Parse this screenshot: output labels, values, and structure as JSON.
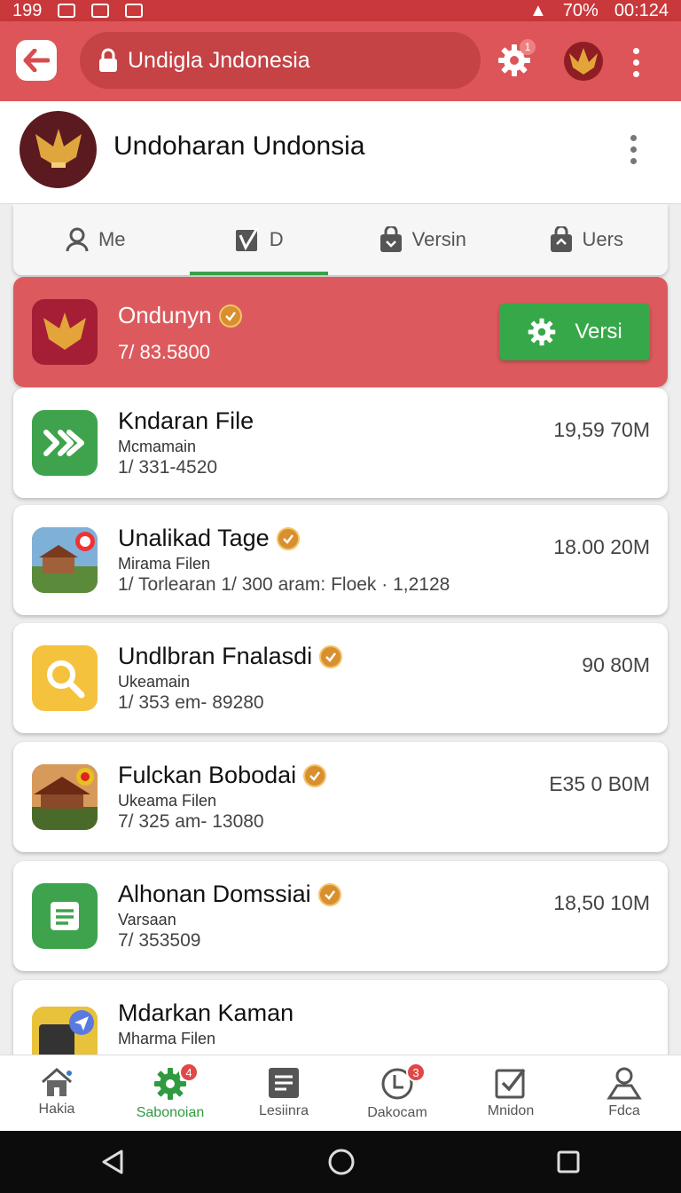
{
  "status_bar": {
    "time_left": "199",
    "battery": "70%",
    "clock": "00:124"
  },
  "app_bar": {
    "url_text": "Undigla Jndonesia",
    "settings_badge": "1"
  },
  "profile": {
    "title": "Undoharan Undonsia"
  },
  "tabs": [
    {
      "label": "Me",
      "icon": "person-icon"
    },
    {
      "label": "D",
      "icon": "edit-box-icon"
    },
    {
      "label": "Versin",
      "icon": "bag-icon"
    },
    {
      "label": "Uers",
      "icon": "bag-icon"
    }
  ],
  "active_tab": 1,
  "featured": {
    "name": "Ondunyn",
    "meta": "7/ 83.5800",
    "button_label": "Versi"
  },
  "items": [
    {
      "name": "Kndaran File",
      "sub": "Mcmamain",
      "meta": "1/ 331-4520",
      "size": "19,59 70M",
      "verified": false,
      "icon": "forward-icon",
      "icon_color": "#3ea34c"
    },
    {
      "name": "Unalikad Tage",
      "sub": "Mirama Filen",
      "meta": "1/ Torlearan 1/ 300 aram: Floek · 1,2128",
      "size": "18.00 20M",
      "verified": true,
      "icon": "photo-thumb",
      "icon_color": "#6b8f4a"
    },
    {
      "name": "Undlbran Fnalasdi",
      "sub": "Ukeamain",
      "meta": "1/ 353 em- 89280",
      "size": "90 80M",
      "verified": true,
      "icon": "search-icon",
      "icon_color": "#f5c23e"
    },
    {
      "name": "Fulckan Bobodai",
      "sub": "Ukeama Filen",
      "meta": "7/ 325 am- 13080",
      "size": "E35 0 B0M",
      "verified": true,
      "icon": "photo-thumb",
      "icon_color": "#8a5a3a"
    },
    {
      "name": "Alhonan Domssiai",
      "sub": "Varsaan",
      "meta": "7/ 353509",
      "size": "18,50 10M",
      "verified": true,
      "icon": "document-icon",
      "icon_color": "#3ea34c"
    },
    {
      "name": "Mdarkan Kaman",
      "sub": "Mharma Filen",
      "meta": "",
      "size": "",
      "verified": false,
      "icon": "send-icon",
      "icon_color": "#e8c23a"
    }
  ],
  "bottom_nav": [
    {
      "label": "Hakia",
      "icon": "home-icon",
      "badge": ""
    },
    {
      "label": "Sabonoian",
      "icon": "gear-icon",
      "badge": "4"
    },
    {
      "label": "Lesiinra",
      "icon": "list-icon",
      "badge": ""
    },
    {
      "label": "Dakocam",
      "icon": "clock-icon",
      "badge": "3"
    },
    {
      "label": "Mnidon",
      "icon": "check-icon",
      "badge": ""
    },
    {
      "label": "Fdca",
      "icon": "user-icon",
      "badge": ""
    }
  ],
  "colors": {
    "primary": "#dd5558",
    "featured": "#dc5a5d",
    "accent_green": "#37a84a",
    "verified": "#d88f2e"
  }
}
